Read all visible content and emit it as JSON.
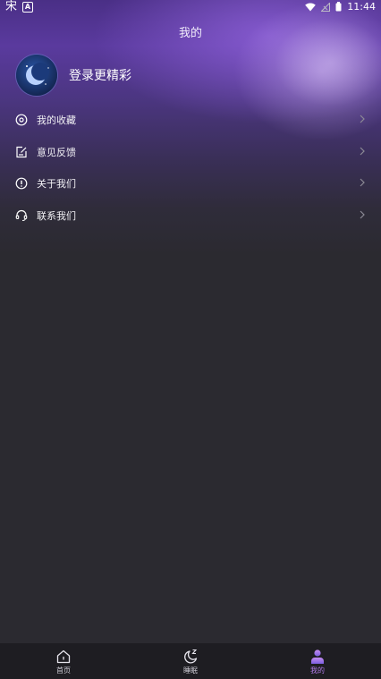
{
  "status_bar": {
    "left_glyph": "宋",
    "left_badge": "A",
    "time": "11:44",
    "icons": [
      "wifi-icon",
      "signal-off-icon",
      "battery-icon"
    ]
  },
  "header": {
    "title": "我的"
  },
  "profile": {
    "login_text": "登录更精彩",
    "avatar_icon": "moon-icon"
  },
  "menu": {
    "items": [
      {
        "label": "我的收藏",
        "icon": "disc-icon"
      },
      {
        "label": "意见反馈",
        "icon": "feedback-edit-icon"
      },
      {
        "label": "关于我们",
        "icon": "info-circle-icon"
      },
      {
        "label": "联系我们",
        "icon": "headset-icon"
      }
    ]
  },
  "tabbar": {
    "tabs": [
      {
        "label": "首页",
        "icon": "home-icon",
        "active": false
      },
      {
        "label": "睡眠",
        "icon": "sleep-moon-icon",
        "active": false
      },
      {
        "label": "我的",
        "icon": "person-icon",
        "active": true
      }
    ]
  },
  "colors": {
    "background": "#2b2a30",
    "hero_purple": "#5a3a9e",
    "tabbar": "#1e1d22",
    "active_tab": "#b07ae6"
  }
}
